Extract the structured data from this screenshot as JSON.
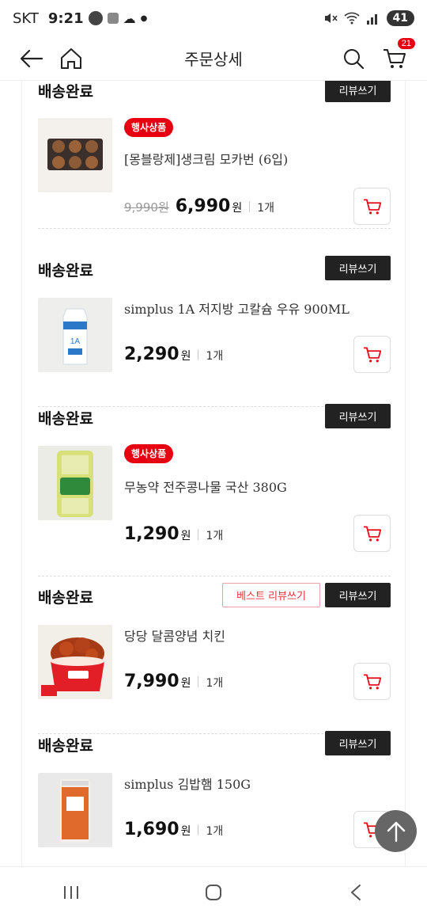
{
  "status_bar": {
    "carrier": "SKT",
    "time": "9:21",
    "battery": "41"
  },
  "header": {
    "title": "주문상세",
    "cart_count": "21"
  },
  "orders": [
    {
      "status": "배송완료",
      "review_label": "리뷰쓰기",
      "badge": "행사상품",
      "name": "[몽블랑제]생크림 모카번 (6입)",
      "original_price": "9,990원",
      "price": "6,990",
      "currency": "원",
      "qty": "1개"
    },
    {
      "status": "배송완료",
      "review_label": "리뷰쓰기",
      "name": "simplus 1A 저지방 고칼슘 우유 900ML",
      "price": "2,290",
      "currency": "원",
      "qty": "1개"
    },
    {
      "status": "배송완료",
      "review_label": "리뷰쓰기",
      "badge": "행사상품",
      "name": "무농약 전주콩나물 국산 380G",
      "price": "1,290",
      "currency": "원",
      "qty": "1개"
    },
    {
      "status": "배송완료",
      "best_review_label": "베스트 리뷰쓰기",
      "review_label": "리뷰쓰기",
      "name": "당당 달콤양념 치킨",
      "price": "7,990",
      "currency": "원",
      "qty": "1개"
    },
    {
      "status": "배송완료",
      "review_label": "리뷰쓰기",
      "name": "simplus 김밥햄 150G",
      "price": "1,690",
      "currency": "원",
      "qty": "1개"
    }
  ],
  "colors": {
    "accent": "#e60012",
    "dark_button": "#222222"
  }
}
